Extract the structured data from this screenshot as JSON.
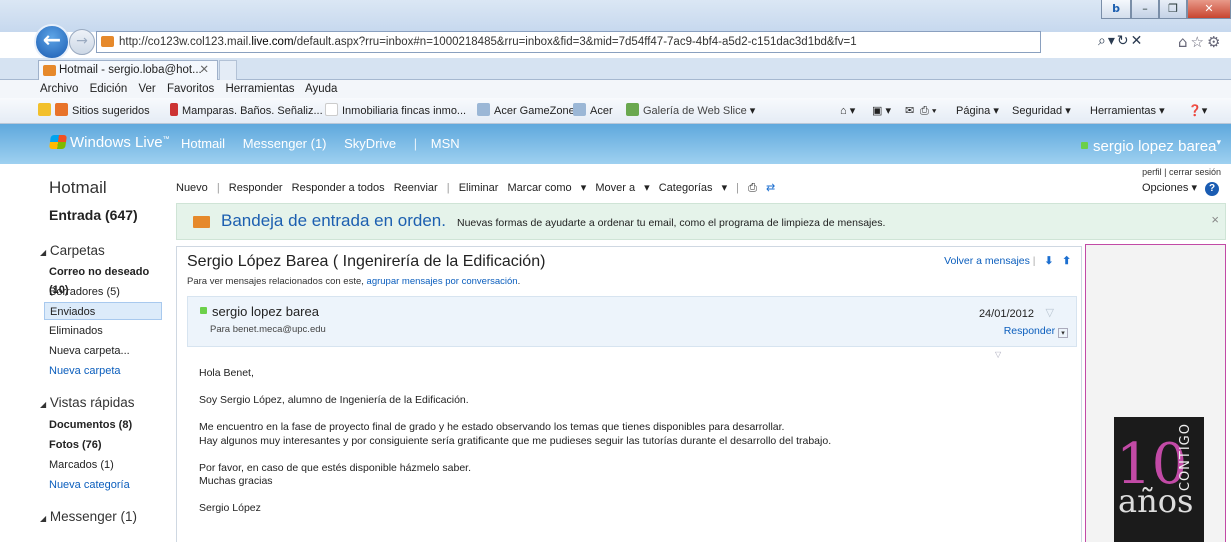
{
  "browser": {
    "url_prefix": "http://co123w.col123.mail.",
    "url_host": "live.com",
    "url_rest": "/default.aspx?rru=inbox#n=1000218485&rru=inbox&fid=3&mid=7d54ff47-7ac9-4bf4-a5d2-c151dac3d1bd&fv=1",
    "tab_title": "Hotmail - sergio.loba@hot...",
    "menu": [
      "Archivo",
      "Edición",
      "Ver",
      "Favoritos",
      "Herramientas",
      "Ayuda"
    ],
    "favorites": {
      "sitios": "Sitios sugeridos",
      "mamparas": "Mamparas. Baños. Señaliz...",
      "inmobiliaria": "Inmobiliaria fincas inmo...",
      "gamezone": "Acer GameZone",
      "acer": "Acer",
      "galeria": "Galería de Web Slice",
      "pagina": "Página",
      "seguridad": "Seguridad",
      "herramientas": "Herramientas"
    }
  },
  "header": {
    "logo": "Windows Live",
    "logo_tm": "™",
    "nav": [
      "Hotmail",
      "Messenger (1)",
      "SkyDrive",
      "MSN"
    ],
    "user": "sergio lopez barea",
    "user_links": "perfil | cerrar sesión"
  },
  "sidebar": {
    "title": "Hotmail",
    "inbox": "Entrada (647)",
    "carpetas": "Carpetas",
    "folders": [
      "Correo no deseado (10)",
      "Borradores (5)",
      "Enviados",
      "Eliminados",
      "Nueva carpeta...",
      "Nueva carpeta"
    ],
    "vistas": "Vistas rápidas",
    "views": [
      "Documentos (8)",
      "Fotos (76)",
      "Marcados (1)",
      "Nueva categoría"
    ],
    "messenger": "Messenger (1)"
  },
  "toolbar": {
    "nuevo": "Nuevo",
    "responder": "Responder",
    "responder_todos": "Responder a todos",
    "reenviar": "Reenviar",
    "eliminar": "Eliminar",
    "marcar": "Marcar como",
    "mover": "Mover a",
    "categorias": "Categorías",
    "opciones": "Opciones"
  },
  "banner": {
    "title": "Bandeja de entrada en orden.",
    "text": "Nuevas formas de ayudarte a ordenar tu email, como el programa de limpieza de mensajes."
  },
  "message": {
    "subject": "Sergio López Barea ( Ingenirería de la Edificación)",
    "related_prefix": "Para ver mensajes relacionados con este,",
    "related_link": "agrupar mensajes por conversación",
    "related_suffix": ".",
    "volver": "Volver a mensajes",
    "sender": "sergio lopez barea",
    "to": "Para benet.meca@upc.edu",
    "date": "24/01/2012",
    "responder": "Responder",
    "body": {
      "greeting": "Hola Benet,",
      "p1": "Soy Sergio López, alumno de Ingeniería de la Edificación.",
      "p2a": "Me encuentro en la fase de proyecto final de grado y he estado observando los temas que tienes disponibles para desarrollar.",
      "p2b": "Hay algunos muy interesantes y por consiguiente sería gratificante que me pudieses seguir las tutorías durante el desarrollo del trabajo.",
      "p3a": "Por favor, en caso de que estés disponible házmelo saber.",
      "p3b": "Muchas gracias",
      "sign": "Sergio López"
    }
  },
  "ad": {
    "ten": "10",
    "anos": "años",
    "contigo": "CONTIGO"
  }
}
